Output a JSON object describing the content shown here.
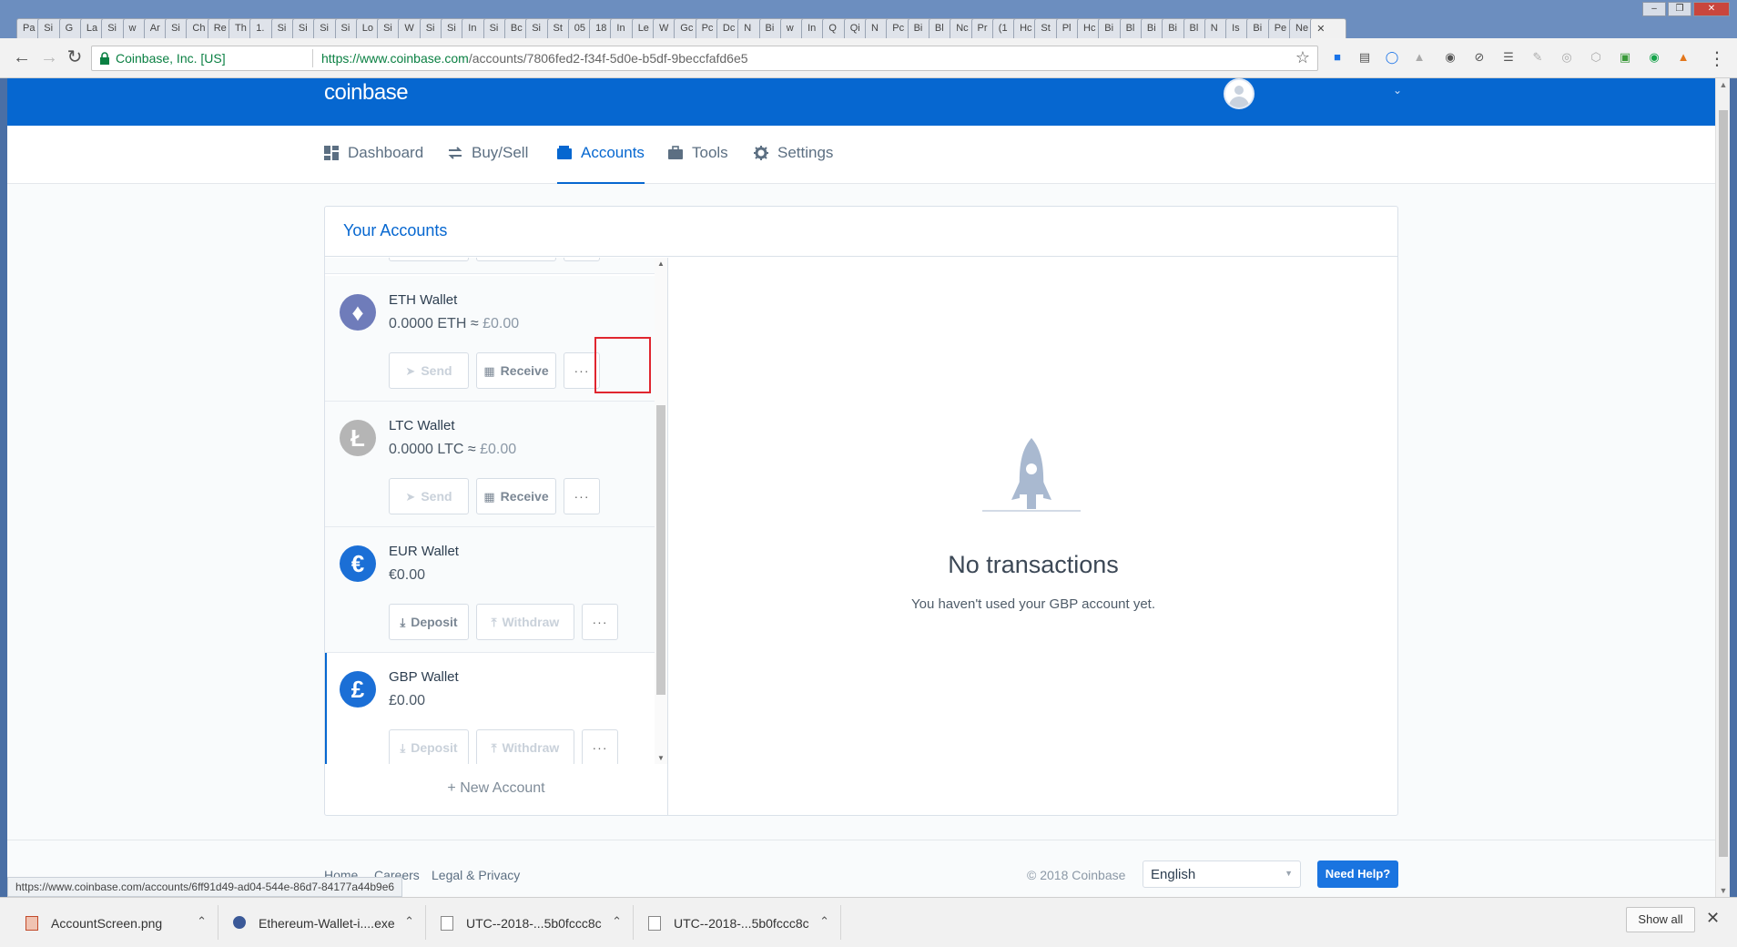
{
  "browser": {
    "tabs": [
      "Pa",
      "Si",
      "G",
      "La",
      "Si",
      "w",
      "Ar",
      "Si",
      "Ch",
      "Re",
      "Th",
      "1.",
      "Si",
      "Si",
      "Si",
      "Si",
      "Lo",
      "Si",
      "W",
      "Si",
      "Si",
      "In",
      "Si",
      "Bc",
      "Si",
      "St",
      "05",
      "18",
      "In",
      "Le",
      "W",
      "Gc",
      "Pc",
      "Dc",
      "N",
      "Bi",
      "w",
      "In",
      "Q",
      "Qi",
      "N",
      "Pc",
      "Bi",
      "Bl",
      "Nc",
      "Pr",
      "(1",
      "Hc",
      "St",
      "Pl",
      "Hc",
      "Bi",
      "Bl",
      "Bi",
      "Bi",
      "Bl",
      "N",
      "Is",
      "Bi",
      "Pe",
      "Ne"
    ],
    "active_tab": "",
    "window_buttons": [
      "–",
      "❐",
      "✕"
    ],
    "omnibox": {
      "secure_label": "Coinbase, Inc. [US]",
      "url_origin": "https://www.coinbase.com",
      "url_path": "/accounts/7806fed2-f34f-5d0e-b5df-9beccfafd6e5"
    },
    "status_url": "https://www.coinbase.com/accounts/6ff91d49-ad04-544e-86d7-84177a44b9e6"
  },
  "header": {
    "logo": "coinbase"
  },
  "nav": {
    "items": [
      {
        "label": "Dashboard",
        "icon": "dashboard-icon"
      },
      {
        "label": "Buy/Sell",
        "icon": "swap-icon"
      },
      {
        "label": "Accounts",
        "icon": "wallet-icon",
        "active": true
      },
      {
        "label": "Tools",
        "icon": "briefcase-icon"
      },
      {
        "label": "Settings",
        "icon": "gear-icon"
      }
    ]
  },
  "accounts": {
    "title": "Your Accounts",
    "list": [
      {
        "name": "ETH Wallet",
        "balance": "0.0000 ETH",
        "approx": "≈",
        "fiat": "£0.00",
        "color": "#6f7cba",
        "symbol": "♦",
        "buttons": [
          "Send",
          "Receive",
          "···"
        ]
      },
      {
        "name": "LTC Wallet",
        "balance": "0.0000 LTC",
        "approx": "≈",
        "fiat": "£0.00",
        "color": "#b5b5b5",
        "symbol": "Ł",
        "buttons": [
          "Send",
          "Receive",
          "···"
        ]
      },
      {
        "name": "EUR Wallet",
        "balance": "€0.00",
        "approx": "",
        "fiat": "",
        "color": "#1b6fd6",
        "symbol": "€",
        "buttons": [
          "Deposit",
          "Withdraw",
          "···"
        ]
      },
      {
        "name": "GBP Wallet",
        "balance": "£0.00",
        "approx": "",
        "fiat": "",
        "color": "#1b6fd6",
        "symbol": "£",
        "buttons": [
          "Deposit",
          "Withdraw",
          "···"
        ]
      }
    ],
    "new_account": "+ New Account"
  },
  "empty_state": {
    "title": "No transactions",
    "subtitle": "You haven't used your GBP account yet."
  },
  "footer": {
    "links": [
      "Home",
      "Careers",
      "Legal & Privacy"
    ],
    "copyright": "© 2018 Coinbase",
    "language": "English",
    "help": "Need Help?"
  },
  "downloads": {
    "items": [
      "AccountScreen.png",
      "Ethereum-Wallet-i....exe",
      "UTC--2018-...5b0fccc8c",
      "UTC--2018-...5b0fccc8c"
    ],
    "show_all": "Show all"
  }
}
